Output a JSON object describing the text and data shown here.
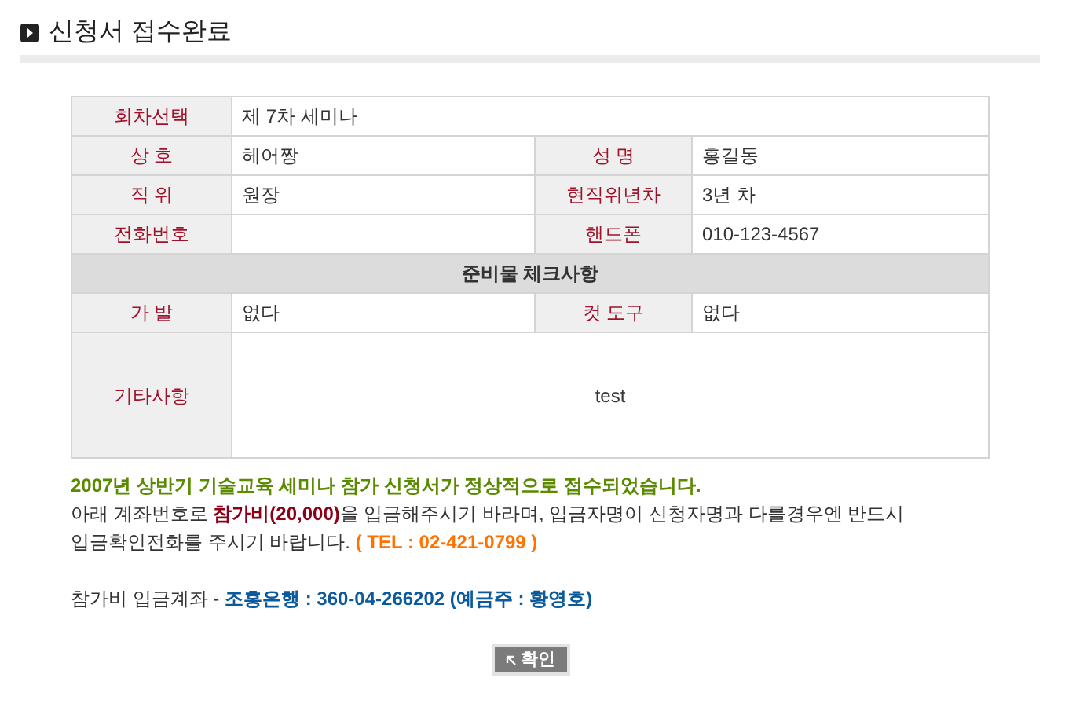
{
  "title": "신청서 접수완료",
  "form_rows": [
    {
      "cells": [
        {
          "label": "회차선택",
          "value": "제 7차 세미나"
        }
      ]
    },
    {
      "cells": [
        {
          "label": "상 호",
          "value": "헤어짱"
        },
        {
          "label": "성 명",
          "value": "홍길동"
        }
      ]
    },
    {
      "cells": [
        {
          "label": "직 위",
          "value": "원장"
        },
        {
          "label": "현직위년차",
          "value": "3년 차"
        }
      ]
    },
    {
      "cells": [
        {
          "label": "전화번호"
        },
        {
          "label": "핸드폰",
          "value": "010-123-4567"
        }
      ]
    }
  ],
  "section_header": "준비물 체크사항",
  "check_rows": [
    {
      "cells": [
        {
          "label": "가 발",
          "value": "없다"
        },
        {
          "label": "컷 도구",
          "value": "없다"
        }
      ]
    }
  ],
  "notes": {
    "label": "기타사항",
    "value": "test"
  },
  "message": {
    "headline": "2007년 상반기 기술교육 세미나 참가 신청서가 정상적으로 접수되었습니다.",
    "segments": [
      {
        "kind": "plain",
        "text": "아래 계좌번호로 "
      },
      {
        "kind": "fee",
        "text": "참가비(20,000)"
      },
      {
        "kind": "plain",
        "text": "을 입금해주시기 바라며, 입금자명이 신청자명과 다를경우엔 반드시 입금확인전화를 주시기 바랍니다. "
      },
      {
        "kind": "tel",
        "text": "( TEL : 02-421-0799 )"
      }
    ],
    "account_segments": [
      {
        "kind": "plain",
        "text": "참가비 입금계좌 - "
      },
      {
        "kind": "account",
        "text": "조흥은행 : 360-04-266202 (예금주 : 황영호)"
      }
    ]
  },
  "confirm_button": "확인"
}
